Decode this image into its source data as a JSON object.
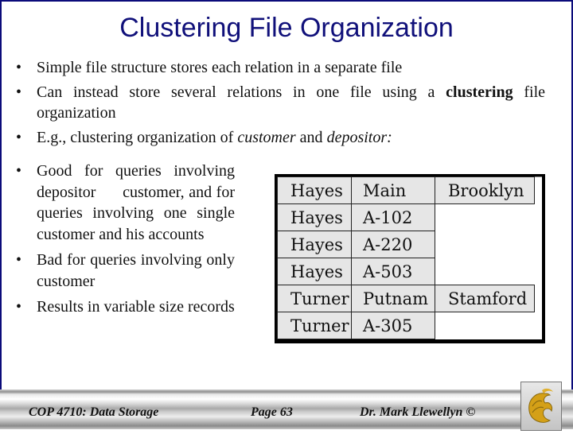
{
  "slide": {
    "title": "Clustering File Organization",
    "bullets_top": [
      {
        "parts": [
          {
            "text": "Simple file structure stores each relation in a separate file",
            "style": "normal"
          }
        ]
      },
      {
        "parts": [
          {
            "text": "Can instead store several relations in one file using a ",
            "style": "normal"
          },
          {
            "text": "clustering",
            "style": "bold"
          },
          {
            "text": " file organization",
            "style": "normal"
          }
        ]
      },
      {
        "parts": [
          {
            "text": "E.g., clustering organization of ",
            "style": "normal"
          },
          {
            "text": "customer",
            "style": "italic"
          },
          {
            "text": " and ",
            "style": "normal"
          },
          {
            "text": "depositor:",
            "style": "italic"
          }
        ]
      }
    ],
    "bullets_left": [
      "Good for queries involving depositor      customer, and for queries involving one single customer and his accounts",
      "Bad for queries involving only customer",
      "Results in variable size records"
    ],
    "bullet_glyph": "•",
    "table": [
      [
        "Hayes",
        "Main",
        "Brooklyn"
      ],
      [
        "Hayes",
        "A-102",
        ""
      ],
      [
        "Hayes",
        "A-220",
        ""
      ],
      [
        "Hayes",
        "A-503",
        ""
      ],
      [
        "Turner",
        "Putnam",
        "Stamford"
      ],
      [
        "Turner",
        "A-305",
        ""
      ]
    ]
  },
  "footer": {
    "course": "COP 4710: Data Storage",
    "page": "Page 63",
    "author": "Dr. Mark Llewellyn ©",
    "logo_icon": "ucf-pegasus-logo"
  },
  "colors": {
    "title": "#10107a",
    "frame": "#0b0b7a",
    "cell_fill": "#e6e6e6",
    "logo_gold": "#d9a520"
  }
}
